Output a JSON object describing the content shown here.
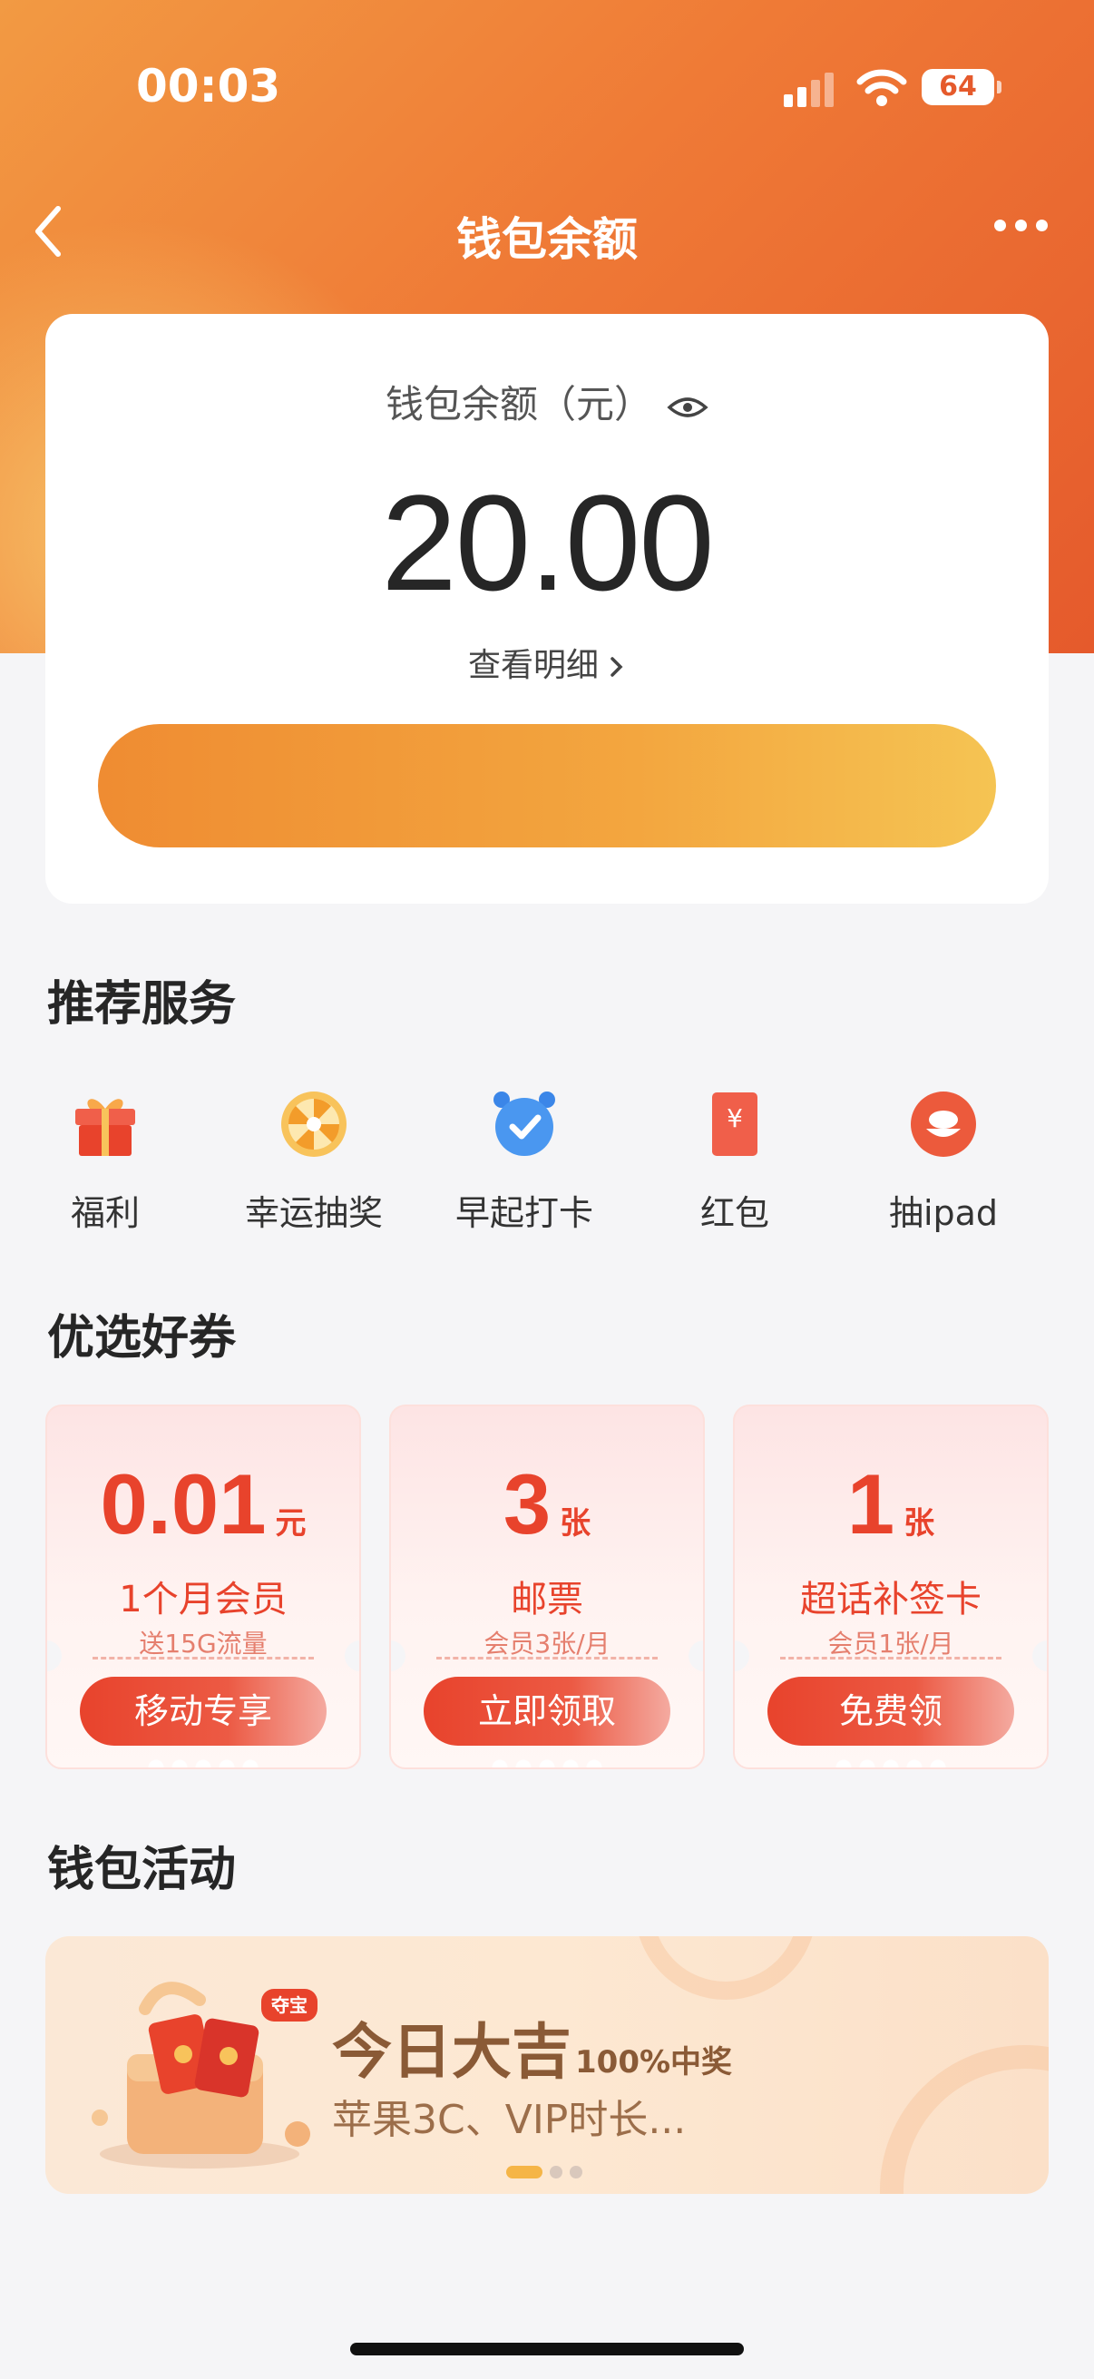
{
  "status_bar": {
    "time": "00:03",
    "battery": "64"
  },
  "nav": {
    "title": "钱包余额"
  },
  "balance": {
    "label": "钱包余额（元）",
    "amount": "20.00",
    "detail_link": "查看明细"
  },
  "recommended": {
    "title": "推荐服务",
    "items": [
      {
        "label": "福利",
        "icon": "gift-icon"
      },
      {
        "label": "幸运抽奖",
        "icon": "lucky-wheel-icon"
      },
      {
        "label": "早起打卡",
        "icon": "alarm-clock-icon"
      },
      {
        "label": "红包",
        "icon": "red-envelope-icon"
      },
      {
        "label": "抽ipad",
        "icon": "ipad-draw-icon"
      }
    ]
  },
  "coupons": {
    "title": "优选好券",
    "items": [
      {
        "value": "0.01",
        "unit": "元",
        "title": "1个月会员",
        "sub": "送15G流量",
        "button": "移动专享"
      },
      {
        "value": "3",
        "unit": "张",
        "title": "邮票",
        "sub": "会员3张/月",
        "button": "立即领取"
      },
      {
        "value": "1",
        "unit": "张",
        "title": "超话补签卡",
        "sub": "会员1张/月",
        "button": "免费领"
      }
    ]
  },
  "activities": {
    "title": "钱包活动",
    "banner": {
      "badge": "夺宝",
      "headline": "今日大吉",
      "headline_suffix": "100%中奖",
      "sub": "苹果3C、VIP时长..."
    }
  },
  "colors": {
    "accent": "#e8432c",
    "header_orange": "#ef7a36",
    "button_orange": "#f3a63f"
  }
}
